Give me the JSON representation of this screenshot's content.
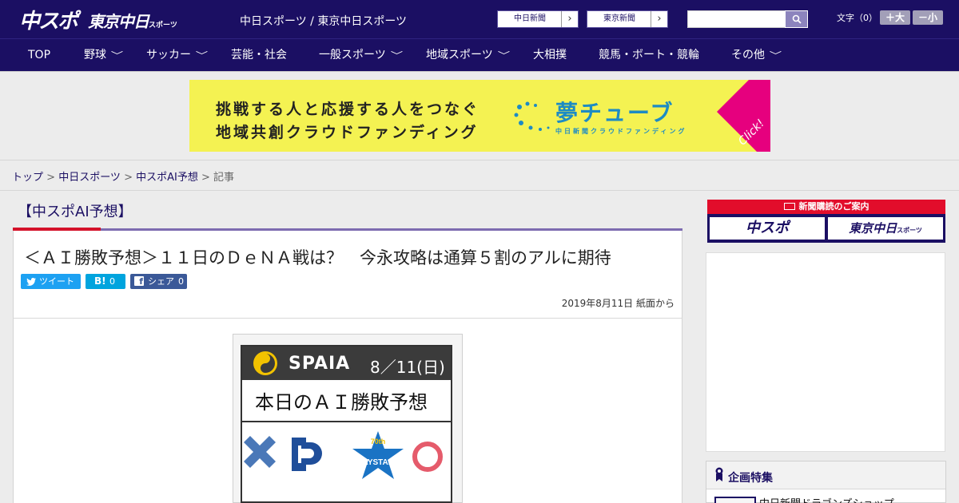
{
  "header": {
    "logo_chuspo": "中スポ",
    "logo_tokyo": "東京中日",
    "logo_tokyo_sub": "スポーツ",
    "site_title": "中日スポーツ / 東京中日スポーツ",
    "btn_chunichi": "中日新聞",
    "btn_tokyo": "東京新聞",
    "font_size_label": "文字（0）",
    "font_larger": "＋大",
    "font_smaller": "－小",
    "search_placeholder": ""
  },
  "nav": {
    "items": [
      "TOP",
      "野球",
      "サッカー",
      "芸能・社会",
      "一般スポーツ",
      "地域スポーツ",
      "大相撲",
      "競馬・ボート・競輪",
      "その他"
    ]
  },
  "banner": {
    "line1": "挑戦する人と応援する人をつなぐ",
    "line2": "地域共創クラウドファンディング",
    "brand": "夢チューブ",
    "brand_sub": "中日新聞クラウドファンディング",
    "click": "Click!"
  },
  "breadcrumb": {
    "top": "トップ",
    "sep": " > ",
    "sports": "中日スポーツ",
    "category": "中スポAI予想",
    "current": "記事"
  },
  "article": {
    "section": "【中スポAI予想】",
    "title": "＜ＡＩ勝敗予想＞１１日のＤｅＮＡ戦は？　今永攻略は通算５割のアルに期待",
    "tweet": "ツイート",
    "hatena": "B!",
    "hatena_count": "0",
    "facebook": "シェア",
    "facebook_count": "0",
    "date": "2019年8月11日 紙面から",
    "card_brand": "SPAIA",
    "card_date": "8／11(日)",
    "card_title": "本日のＡＩ勝敗予想"
  },
  "sidebar": {
    "subscribe_title": "新聞購読のご案内",
    "sub_chuspo": "中スポ",
    "sub_tokyo": "東京中日",
    "sub_tokyo_small": "スポーツ",
    "feature_title": "企画特集",
    "feature_item": "中日新聞ドラゴンズショップ"
  },
  "colors": {
    "brand_navy": "#1b0f63",
    "accent_red": "#d4122a",
    "twitter": "#1da1f2",
    "hatena": "#00a4de",
    "facebook": "#3b5998"
  }
}
